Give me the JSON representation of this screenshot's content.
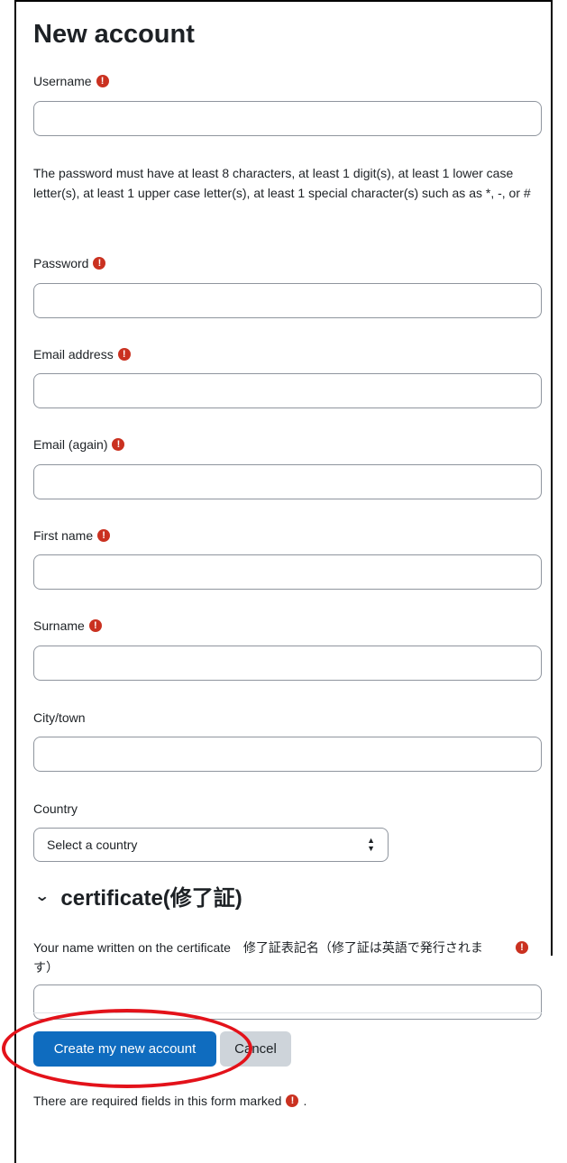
{
  "page_title": "New account",
  "required_icon": "exclamation-circle-icon",
  "required_glyph": "!",
  "colors": {
    "primary": "#0f6cbf",
    "required": "#ca3120",
    "highlight": "#e3121a"
  },
  "fields": {
    "username": {
      "label": "Username",
      "value": ""
    },
    "password_hint": "The password must have at least 8 characters, at least 1 digit(s), at least 1 lower case letter(s), at least 1 upper case letter(s), at least 1 special character(s) such as as *, -, or #",
    "password": {
      "label": "Password",
      "value": ""
    },
    "email": {
      "label": "Email address",
      "value": ""
    },
    "email_again": {
      "label": "Email (again)",
      "value": ""
    },
    "first_name": {
      "label": "First name",
      "value": ""
    },
    "surname": {
      "label": "Surname",
      "value": ""
    },
    "city": {
      "label": "City/town",
      "value": ""
    },
    "country": {
      "label": "Country",
      "selected": "Select a country"
    }
  },
  "certificate_section": {
    "title": "certificate(修了証)",
    "field_label": "Your name written on the certificate　修了証表記名（修了証は英語で発行されます）",
    "value": ""
  },
  "buttons": {
    "submit": "Create my new account",
    "cancel": "Cancel"
  },
  "footer_note": "There are required fields in this form marked",
  "footer_trail": "."
}
